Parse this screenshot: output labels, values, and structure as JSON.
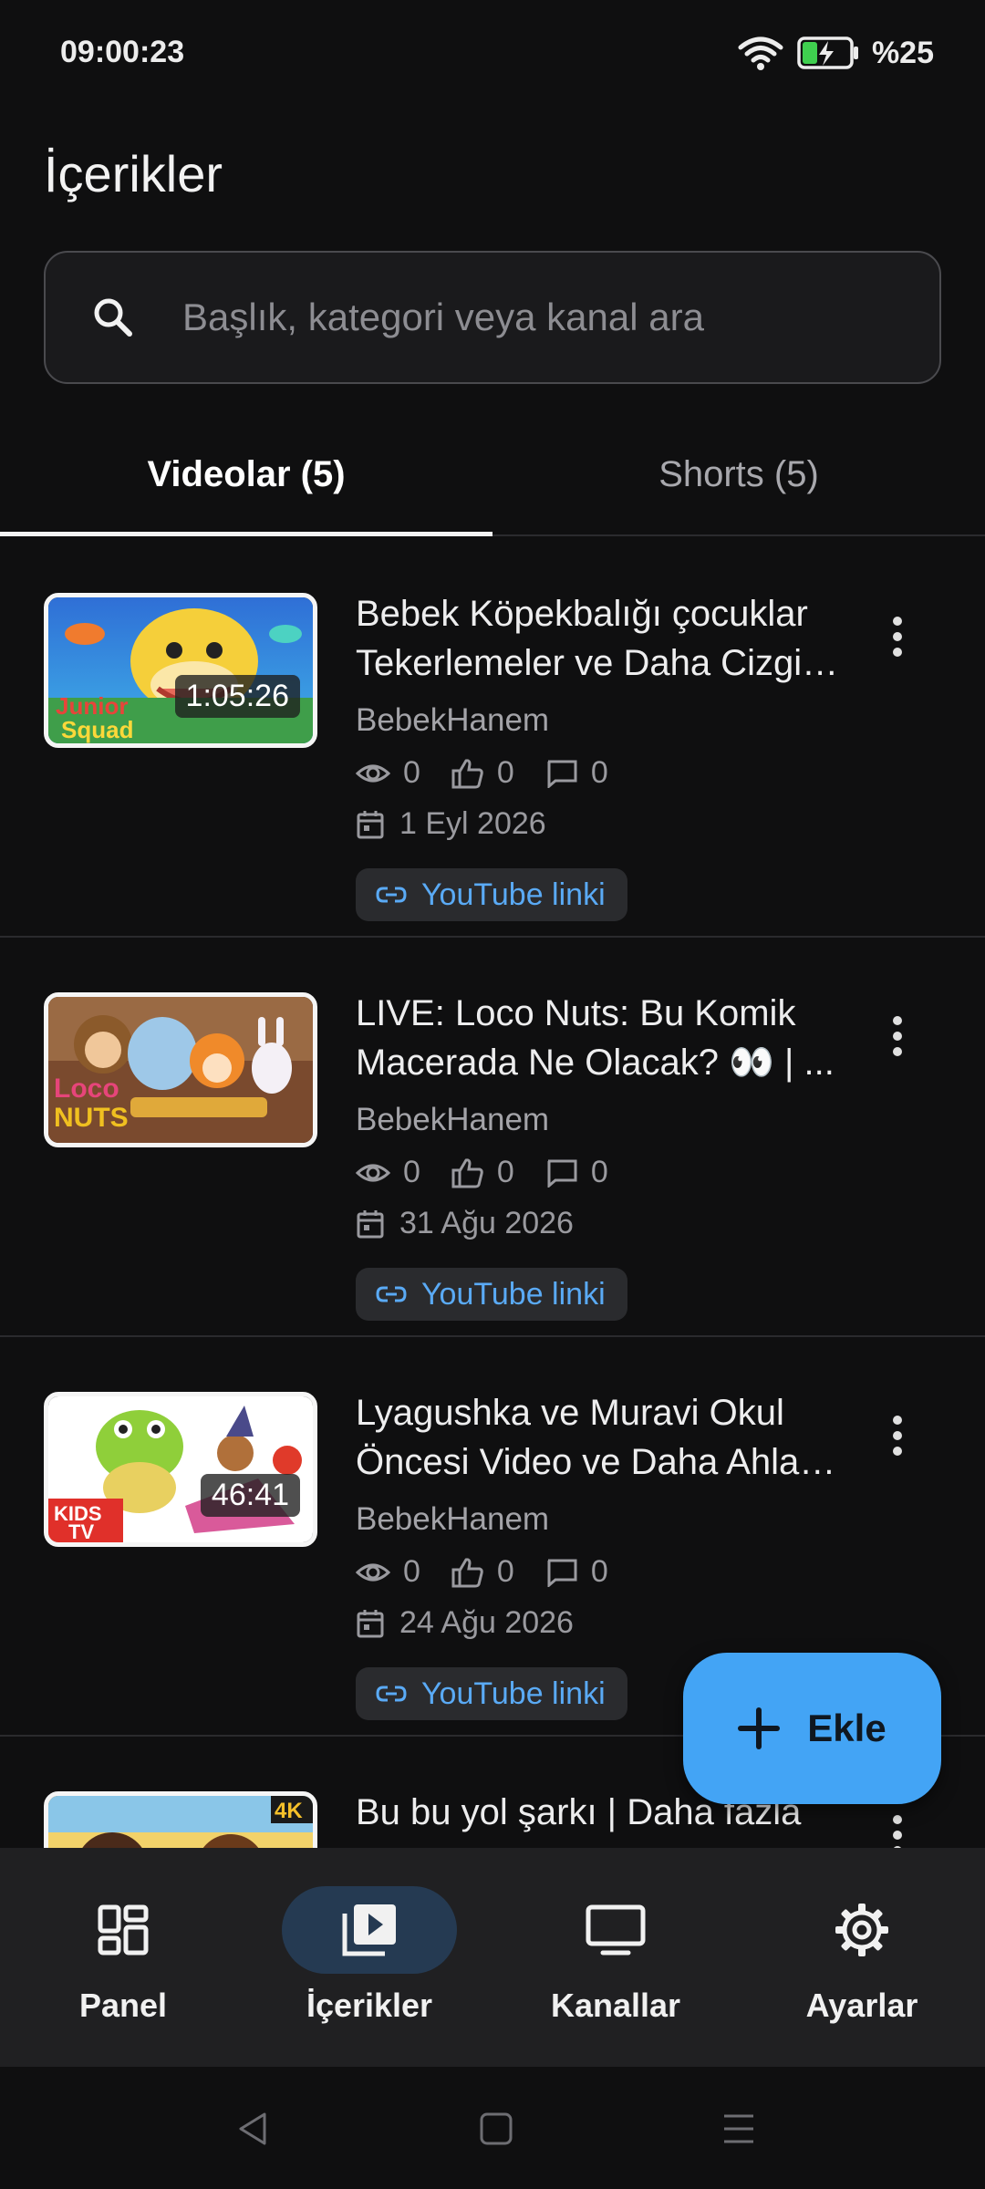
{
  "status_bar": {
    "time": "09:00:23",
    "battery": "%25"
  },
  "header": {
    "title": "İçerikler"
  },
  "search": {
    "placeholder": "Başlık, kategori veya kanal ara"
  },
  "tabs": [
    {
      "label": "Videolar (5)",
      "active": true
    },
    {
      "label": "Shorts (5)",
      "active": false
    }
  ],
  "videos": [
    {
      "title": "Bebek Köpekbalığı çocuklar Tekerlemeler ve Daha Cizgi Film",
      "channel": "BebekHanem",
      "duration": "1:05:26",
      "views": "0",
      "likes": "0",
      "comments": "0",
      "date": "1 Eyl 2026",
      "link_label": "YouTube linki"
    },
    {
      "title": "LIVE: Loco Nuts: Bu Komik Macerada Ne Olacak? 👀 | ...",
      "channel": "BebekHanem",
      "duration": "",
      "views": "0",
      "likes": "0",
      "comments": "0",
      "date": "31 Ağu 2026",
      "link_label": "YouTube linki"
    },
    {
      "title": "Lyagushka ve Muravi Okul Öncesi Video ve Daha Ahlak Hikayeleri",
      "channel": "BebekHanem",
      "duration": "46:41",
      "views": "0",
      "likes": "0",
      "comments": "0",
      "date": "24 Ağu 2026",
      "link_label": "YouTube linki"
    },
    {
      "title": "Bu bu yol şarkı | Daha fazla",
      "channel": "",
      "duration": "",
      "badge": "4K",
      "views": "",
      "likes": "",
      "comments": "",
      "date": "",
      "link_label": ""
    }
  ],
  "fab": {
    "label": "Ekle"
  },
  "bottom_nav": [
    {
      "label": "Panel",
      "icon": "dashboard-icon"
    },
    {
      "label": "İçerikler",
      "icon": "video-library-icon",
      "active": true
    },
    {
      "label": "Kanallar",
      "icon": "tv-icon"
    },
    {
      "label": "Ayarlar",
      "icon": "gear-icon"
    }
  ],
  "colors": {
    "accent": "#43a4f5",
    "link": "#5aaaf5",
    "background": "#0f0f10"
  }
}
